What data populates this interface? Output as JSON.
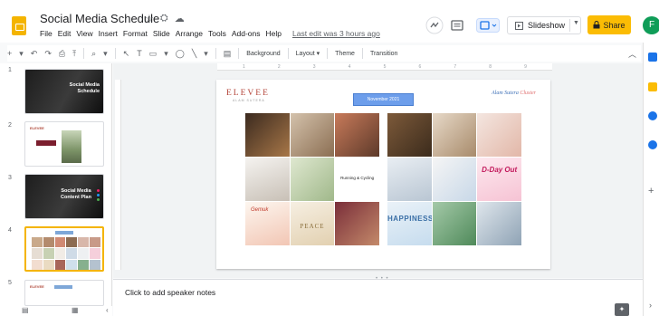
{
  "header": {
    "title": "Social Media Schedule",
    "title_icons": [
      "☆",
      "⛭",
      "☁"
    ],
    "menu": [
      "File",
      "Edit",
      "View",
      "Insert",
      "Format",
      "Slide",
      "Arrange",
      "Tools",
      "Add-ons",
      "Help"
    ],
    "last_edit": "Last edit was 3 hours ago",
    "slideshow_label": "Slideshow",
    "share_label": "Share",
    "avatar_letter": "F"
  },
  "toolbar": {
    "icons": [
      "+",
      "▾",
      "↶",
      "↷",
      "⎙",
      "⤒",
      "⌕",
      "▾",
      "↖",
      "T",
      "▭",
      "▾",
      "◯",
      "╲",
      "▾",
      "▤"
    ],
    "background_label": "Background",
    "layout_label": "Layout",
    "theme_label": "Theme",
    "transition_label": "Transition"
  },
  "filmstrip": {
    "slides": [
      {
        "number": "1",
        "kind": "dark",
        "title": "Social Media Schedule"
      },
      {
        "number": "2",
        "kind": "light",
        "title": ""
      },
      {
        "number": "3",
        "kind": "dark",
        "title": "Social Media Content Plan"
      },
      {
        "number": "4",
        "kind": "light",
        "title": ""
      },
      {
        "number": "5",
        "kind": "light",
        "title": ""
      }
    ]
  },
  "ruler_marks": [
    "1",
    "2",
    "3",
    "4",
    "5",
    "6",
    "7",
    "8",
    "9"
  ],
  "slide": {
    "brand": "ELEVEE",
    "brand_sub": "ALAM SUTERA",
    "month_label": "November 2021",
    "right_logo_a": "Alam Sutera",
    "right_logo_b": "Cluster",
    "left_cells": [
      {
        "bg": "linear-gradient(135deg,#3b2a1f,#a87748)",
        "text": ""
      },
      {
        "bg": "linear-gradient(135deg,#d4c2ac,#8b6e52)",
        "text": ""
      },
      {
        "bg": "linear-gradient(135deg,#c87a5a,#5d3a2a)",
        "text": ""
      },
      {
        "bg": "linear-gradient(160deg,#f5f3f0,#c8c0b6)",
        "text": ""
      },
      {
        "bg": "linear-gradient(135deg,#dfe8d0,#a0b88a)",
        "text": ""
      },
      {
        "bg": "#ffffff",
        "text": "Running & Cycling"
      },
      {
        "bg": "linear-gradient(160deg,#fdf6ef,#f2c6b4)",
        "text": ""
      },
      {
        "bg": "linear-gradient(160deg,#f6efe2,#e2d0b0)",
        "text": ""
      },
      {
        "bg": "linear-gradient(135deg,#7a2e3a,#c48a6a)",
        "text": ""
      }
    ],
    "right_cells": [
      {
        "bg": "linear-gradient(135deg,#7d5a3a,#3b2b1c)",
        "text": ""
      },
      {
        "bg": "linear-gradient(135deg,#e7d9c8,#a88b6b)",
        "text": ""
      },
      {
        "bg": "linear-gradient(135deg,#f4e6e0,#e2b7a8)",
        "text": ""
      },
      {
        "bg": "linear-gradient(160deg,#e9eef3,#b9c6d3)",
        "text": ""
      },
      {
        "bg": "linear-gradient(135deg,#f5f5f5,#c8d8e8)",
        "text": ""
      },
      {
        "bg": "linear-gradient(160deg,#fde9ef,#f6c3d4)",
        "text": ""
      },
      {
        "bg": "linear-gradient(160deg,#eaf2f8,#c6dcee)",
        "text": ""
      },
      {
        "bg": "linear-gradient(135deg,#a4c9a8,#4f8a5a)",
        "text": ""
      },
      {
        "bg": "linear-gradient(135deg,#dfe6ec,#8fa3b5)",
        "text": ""
      }
    ],
    "peace_text": "PEACE",
    "happiness_text": "HAPPINESS",
    "dday_text": "D-Day Out",
    "gm_text": "Gemuk"
  },
  "notes": {
    "placeholder": "Click to add speaker notes"
  },
  "colors": {
    "brand_yellow": "#f4b400",
    "share": "#fbbc04",
    "month_banner": "#6d9eeb",
    "active_thumb_border": "#f4b400"
  }
}
